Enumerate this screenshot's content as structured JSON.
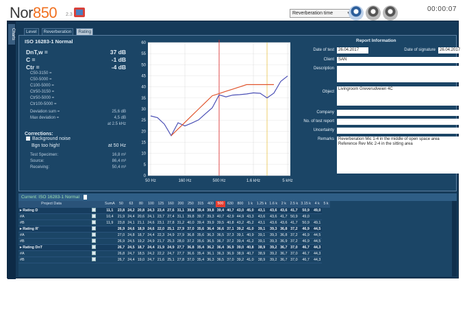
{
  "app": {
    "logo_prefix": "Nor",
    "logo_number": "850",
    "logo_suffix": "2.3",
    "mode": "Reverberation time",
    "timer": "00:00:07",
    "side_tab": "Charts"
  },
  "tabs": [
    "Level",
    "Reverberation",
    "Rating"
  ],
  "left": {
    "title": "ISO 16283-1 Normal",
    "main": [
      {
        "k": "DnT,w =",
        "v": "37 dB"
      },
      {
        "k": "C =",
        "v": "-1 dB"
      },
      {
        "k": "Ctr =",
        "v": "-4 dB"
      }
    ],
    "spectra": [
      "C50-3150 =",
      "C50-5000 =",
      "C100-5000 =",
      "Ctr50-3150 =",
      "Ctr50-5000 =",
      "Ctr100-5000 ="
    ],
    "deviation": [
      {
        "k": "Deviation sum =",
        "v": "25,6 dB"
      },
      {
        "k": "Max deviation =",
        "v": "4,5 dB"
      },
      {
        "k": "",
        "v": "at 2.5 kHz"
      }
    ],
    "corrections_title": "Corrections:",
    "corr": [
      {
        "k": "Background noise",
        "v": ""
      },
      {
        "k": "Bgn too high!",
        "v": "at 50 Hz"
      }
    ],
    "areas": [
      {
        "k": "Test Specimen:",
        "v": "16,8 m²"
      },
      {
        "k": "Source:",
        "v": "86,4 m³"
      },
      {
        "k": "Receiving:",
        "v": "50,4 m³"
      }
    ]
  },
  "chart_data": {
    "type": "line",
    "y_ticks": [
      "60",
      "55",
      "50",
      "45",
      "40",
      "35",
      "30",
      "25",
      "20",
      "15",
      "10",
      "5",
      "0"
    ],
    "x_ticks": [
      "50 Hz",
      "160 Hz",
      "500 Hz",
      "1.6 kHz",
      "5 kHz"
    ],
    "ylim": [
      0,
      60
    ],
    "x": [
      "50",
      "63",
      "80",
      "100",
      "125",
      "160",
      "200",
      "250",
      "315",
      "400",
      "500",
      "630",
      "800",
      "1k",
      "1.25k",
      "1.6k",
      "2k",
      "2.5k",
      "3.15k",
      "4k",
      "5k"
    ],
    "series": [
      {
        "values": [
          26.9,
          26.1,
          23.2,
          18.0,
          23.8,
          22.4,
          23.7,
          25.1,
          27.9,
          30.6,
          36.4,
          35.5,
          36.3,
          36.5,
          36.8,
          37.3,
          37.1,
          35.0,
          37.2,
          42.5,
          44.9
        ],
        "color": "#4a4fb5"
      },
      {
        "values": [
          null,
          null,
          null,
          18.0,
          21.0,
          24.0,
          27.0,
          30.0,
          33.0,
          36.0,
          37.0,
          38.0,
          39.0,
          40.0,
          41.0,
          41.0,
          41.0,
          41.0,
          41.0,
          null,
          null
        ],
        "color": "#e0552e"
      }
    ]
  },
  "report": {
    "title": "Report Information",
    "date_label": "Date of test",
    "date": "26.04.2017",
    "sig_label": "Date of signature",
    "sig": "26.04.2017",
    "client_label": "Client",
    "client": "SAN",
    "desc_label": "Description",
    "object_label": "Object",
    "object": "Livingroom Greverudveien 4C",
    "company_label": "Company",
    "no_label": "No. of test report",
    "unc_label": "Uncertainty",
    "remarks_label": "Remarks",
    "remarks1": "Reverberation Mic 1-4 in the middle of open space area",
    "remarks2": "Reference Rev Mic 2-4 in the sitting area"
  },
  "current_label": "Current: ISO 16283-1 Normal",
  "table": {
    "headers": [
      "Project Data",
      "",
      "SumA",
      "50",
      "63",
      "80",
      "100",
      "125",
      "160",
      "200",
      "250",
      "315",
      "400",
      "500",
      "630",
      "800",
      "1 k",
      "1.25 k",
      "1.6 k",
      "2 k",
      "2.5 k",
      "3.15 k",
      "4 k",
      "5 k"
    ],
    "highlight": 13,
    "rows": [
      {
        "g": true,
        "l": "Rating D",
        "c": [
          "11,1",
          "23,8",
          "24,2",
          "20,8",
          "24,3",
          "23,4",
          "27,6",
          "31,1",
          "39,8",
          "39,4",
          "39,8",
          "39,4",
          "40,7",
          "43,0",
          "45,0",
          "43,1",
          "43,6",
          "43,6",
          "41,7",
          "50,9",
          "49,0"
        ]
      },
      {
        "g": false,
        "l": "#A",
        "c": [
          "10,4",
          "21,9",
          "24,4",
          "20,6",
          "24,1",
          "23,7",
          "27,4",
          "31,1",
          "39,8",
          "39,7",
          "39,3",
          "40,7",
          "42,9",
          "44,9",
          "43,3",
          "43,6",
          "43,6",
          "41,7",
          "50,9",
          "49,0",
          ""
        ]
      },
      {
        "g": false,
        "l": "#B",
        "c": [
          "11,9",
          "23,8",
          "24,1",
          "21,1",
          "24,6",
          "23,1",
          "27,8",
          "31,2",
          "40,0",
          "39,4",
          "39,9",
          "39,5",
          "40,8",
          "43,2",
          "45,2",
          "43,1",
          "43,6",
          "43,6",
          "41,7",
          "50,9",
          "49,1"
        ]
      },
      {
        "g": true,
        "l": "Rating R'",
        "c": [
          "",
          "26,9",
          "24,6",
          "18,9",
          "24,6",
          "22,0",
          "25,1",
          "27,9",
          "37,0",
          "35,6",
          "36,4",
          "36,6",
          "37,1",
          "39,2",
          "41,0",
          "39,1",
          "39,3",
          "36,8",
          "37,2",
          "46,9",
          "44,5"
        ]
      },
      {
        "g": false,
        "l": "#A",
        "c": [
          "",
          "27,0",
          "24,8",
          "18,7",
          "24,4",
          "22,3",
          "24,9",
          "27,9",
          "36,8",
          "35,6",
          "36,3",
          "36,5",
          "37,3",
          "39,1",
          "40,9",
          "39,1",
          "39,3",
          "36,8",
          "37,2",
          "46,9",
          "44,5"
        ]
      },
      {
        "g": false,
        "l": "#B",
        "c": [
          "",
          "26,9",
          "24,5",
          "19,2",
          "24,9",
          "21,7",
          "25,3",
          "28,0",
          "37,2",
          "35,6",
          "36,5",
          "36,7",
          "37,2",
          "39,4",
          "41,2",
          "39,1",
          "39,3",
          "36,9",
          "37,2",
          "46,9",
          "44,5"
        ]
      },
      {
        "g": true,
        "l": "Rating DnT",
        "c": [
          "",
          "26,7",
          "24,5",
          "18,7",
          "24,4",
          "21,9",
          "24,9",
          "27,7",
          "36,8",
          "35,4",
          "36,2",
          "36,4",
          "36,9",
          "39,0",
          "40,8",
          "38,9",
          "39,2",
          "36,7",
          "37,0",
          "46,7",
          "44,3"
        ]
      },
      {
        "g": false,
        "l": "#A",
        "c": [
          "",
          "26,8",
          "24,7",
          "18,5",
          "24,2",
          "22,2",
          "24,7",
          "27,7",
          "36,6",
          "35,4",
          "36,1",
          "36,3",
          "36,9",
          "38,9",
          "40,7",
          "38,9",
          "39,2",
          "36,7",
          "37,0",
          "46,7",
          "44,3"
        ]
      },
      {
        "g": false,
        "l": "#B",
        "c": [
          "",
          "26,7",
          "24,4",
          "19,0",
          "24,7",
          "21,6",
          "25,1",
          "27,8",
          "37,0",
          "35,4",
          "36,3",
          "36,5",
          "37,0",
          "39,2",
          "41,0",
          "38,9",
          "39,2",
          "36,7",
          "37,0",
          "46,7",
          "44,3"
        ]
      }
    ]
  }
}
